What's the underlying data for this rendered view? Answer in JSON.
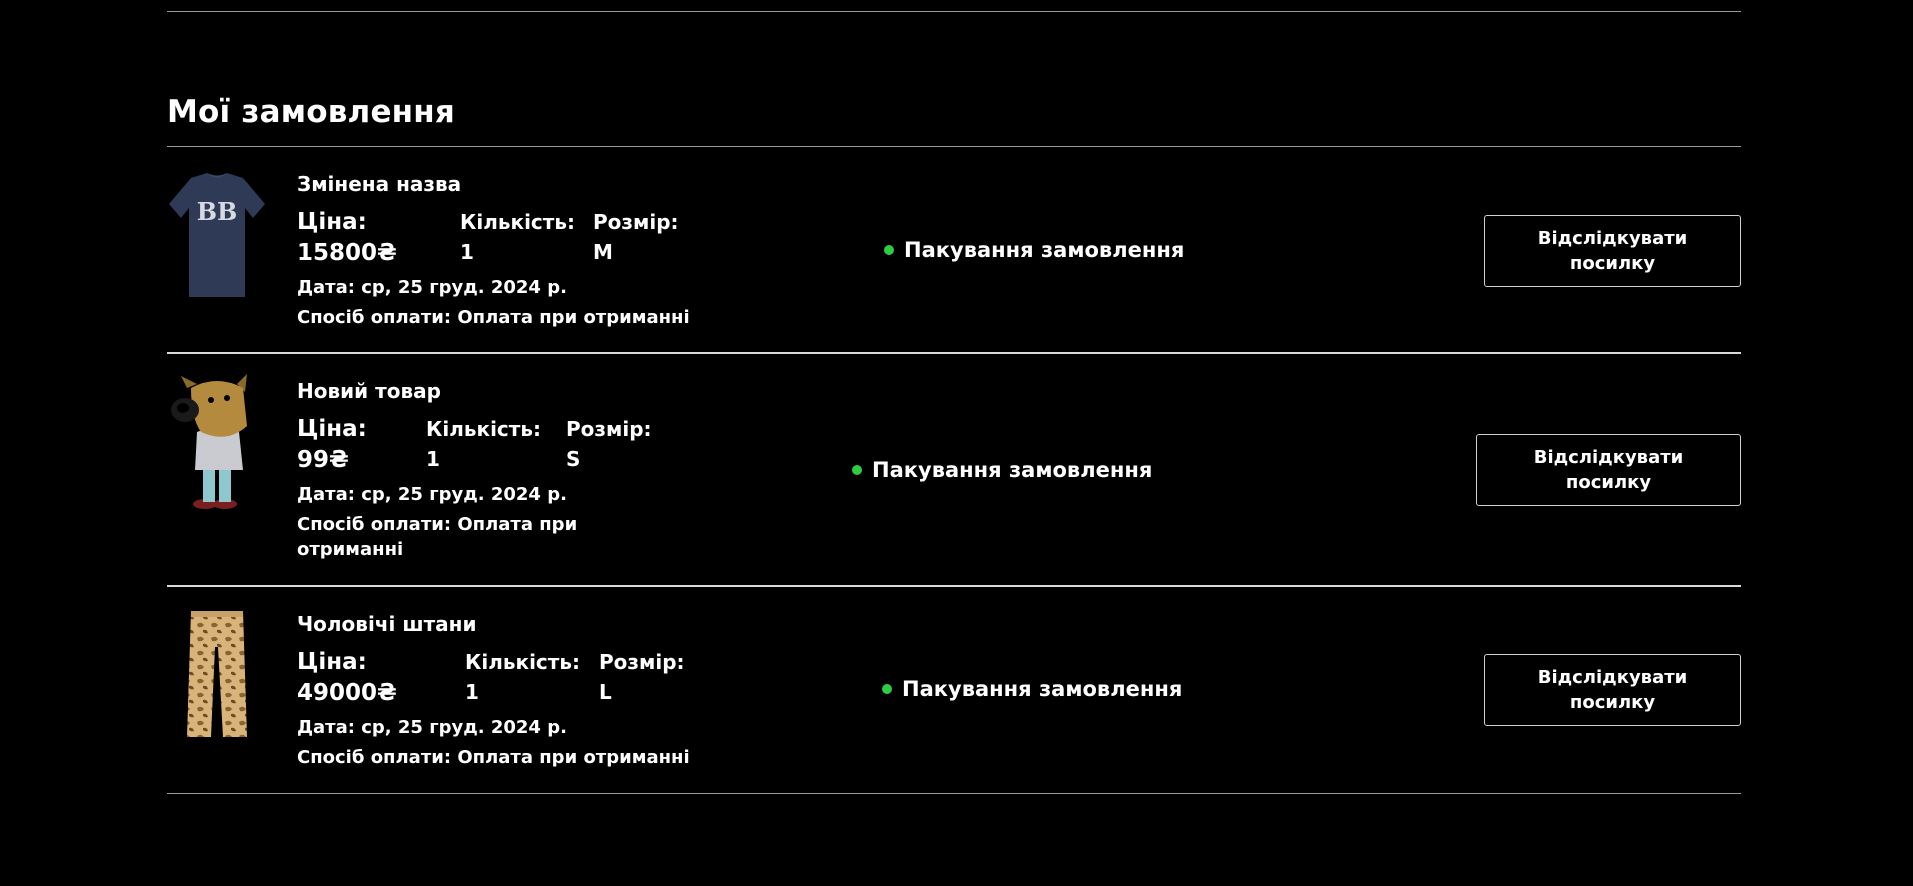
{
  "page": {
    "title": "Мої замовлення"
  },
  "labels": {
    "price": "Ціна:",
    "quantity": "Кількість:",
    "size": "Розмір:",
    "track_button": "Відслідкувати посилку"
  },
  "orders": [
    {
      "name": "Змінена назва",
      "price": "15800₴",
      "quantity": "1",
      "size": "M",
      "date": "Дата: ср, 25 груд. 2024 р.",
      "payment": "Спосіб оплати: Оплата при отриманні",
      "status": "Пакування замовлення",
      "image": "navy-tshirt"
    },
    {
      "name": "Новий товар",
      "price": "99₴",
      "quantity": "1",
      "size": "S",
      "date": "Дата: ср, 25 груд. 2024 р.",
      "payment": "Спосіб оплати: Оплата при отриманні",
      "status": "Пакування замовлення",
      "image": "cartoon-dog-character"
    },
    {
      "name": "Чоловічі штани",
      "price": "49000₴",
      "quantity": "1",
      "size": "L",
      "date": "Дата: ср, 25 груд. 2024 р.",
      "payment": "Спосіб оплати: Оплата при отриманні",
      "status": "Пакування замовлення",
      "image": "camo-pants"
    }
  ],
  "colors": {
    "background": "#000000",
    "text": "#ffffff",
    "status_dot": "#2ecc40",
    "divider": "#9a9a9a"
  }
}
